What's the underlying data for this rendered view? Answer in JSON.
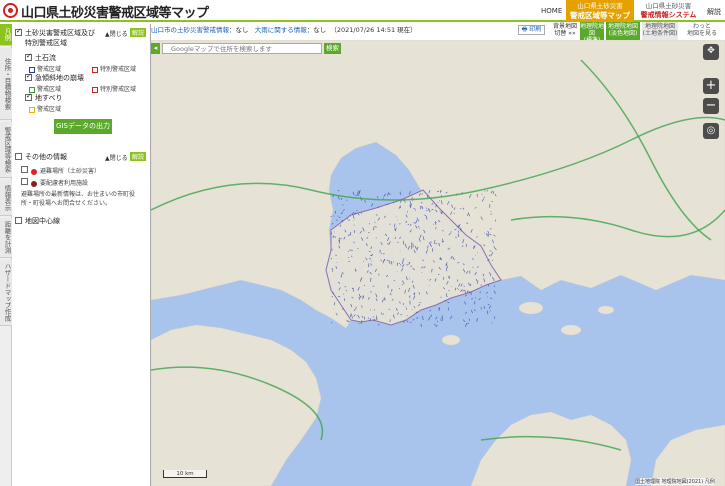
{
  "header": {
    "title": "山口県土砂災害警戒区域等マップ",
    "home": "HOME",
    "tab_active_line1": "山口県土砂災害",
    "tab_active_line2": "警戒区域等マップ",
    "tab_other_line1": "山口県土砂災害",
    "tab_other_line2": "警戒情報システム",
    "help": "解説"
  },
  "vertical_tabs": [
    "凡例",
    "住所・目標物検索",
    "警戒区域等検索",
    "情報表示",
    "距離を計測",
    "ハザードマップ作成"
  ],
  "sidebar": {
    "main_section": {
      "title_line1": "土砂災害警戒区域及び",
      "title_line2": "特別警戒区域",
      "collapse": "▲閉じる",
      "help": "解説",
      "groups": [
        {
          "name": "土石流",
          "checked": true,
          "items": [
            {
              "label": "警戒区域",
              "color": "#2a3ea0"
            },
            {
              "label": "特別警戒区域",
              "color": "#d22020"
            }
          ]
        },
        {
          "name": "急傾斜地の崩壊",
          "checked": true,
          "items": [
            {
              "label": "警戒区域",
              "color": "#3a9a3a"
            },
            {
              "label": "特別警戒区域",
              "color": "#d22020"
            }
          ]
        },
        {
          "name": "地すべり",
          "checked": true,
          "items": [
            {
              "label": "警戒区域",
              "color": "#e6b400"
            }
          ]
        }
      ],
      "gis_button": "GISデータの出力"
    },
    "other_section": {
      "title": "その他の情報",
      "collapse": "▲閉じる",
      "help": "解説",
      "items": [
        {
          "label": "避難場所（土砂災害）",
          "color": "#e02020"
        },
        {
          "label": "要配慮者利用施設",
          "color": "#8a2020"
        }
      ],
      "note_line1": "避難場所の最新情報は、お住まいの市町役",
      "note_line2": "所・町役場へお問合せください。"
    },
    "map_center_line": "地図中心線"
  },
  "infobar": {
    "warning_link": "山口市の土砂災害警戒情報",
    "warning_value": "：なし",
    "rain_link": "大雨に関する情報",
    "rain_value": "：なし",
    "timestamp": "（2021/07/26 14:51 現在）",
    "print": "印刷"
  },
  "map_buttons": [
    {
      "line1": "背景地図",
      "line2": "切替 »»",
      "bg": "#ffffff",
      "fg": "#333333"
    },
    {
      "line1": "地理院地図",
      "line2": "(標準)",
      "bg": "#5ba82b",
      "fg": "#ffffff"
    },
    {
      "line1": "地理院地図",
      "line2": "(淡色地図)",
      "bg": "#5ba82b",
      "fg": "#ffffff"
    },
    {
      "line1": "地理院地図",
      "line2": "(土地条件図)",
      "bg": "#e8e8e8",
      "fg": "#555555"
    },
    {
      "line1": "わっと",
      "line2": "地図を見る",
      "bg": "#ffffff",
      "fg": "#555555"
    }
  ],
  "search": {
    "placeholder": "Googleマップで住所を検索します",
    "button": "検索"
  },
  "map": {
    "scale": "10 km",
    "attribution": "国土地理院 地理院地図(2021) 凡例",
    "colors": {
      "sea": "#a9c4ec",
      "land": "#e6e2d6",
      "prefecture": "#e3e0d8",
      "hazard": "#2a3ea0",
      "road": "#3fa34d"
    }
  }
}
